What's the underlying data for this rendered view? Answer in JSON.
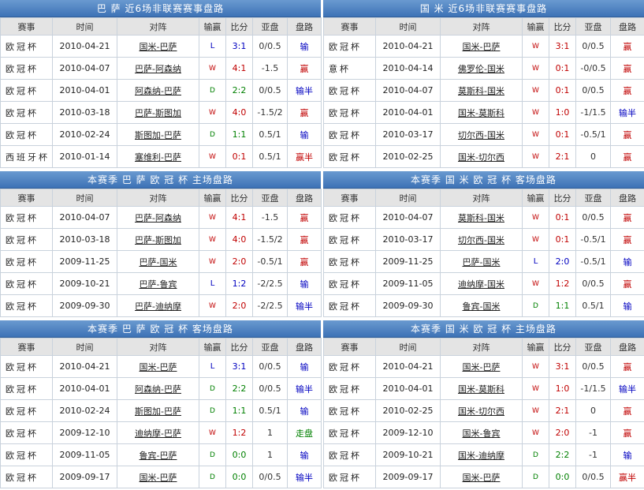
{
  "columns": [
    "赛事",
    "时间",
    "对阵",
    "输赢",
    "比分",
    "亚盘",
    "盘路"
  ],
  "panels": [
    {
      "title": "巴 萨 近6场非联赛赛事盘路",
      "rows": [
        {
          "comp": "欧冠杯",
          "date": "2010-04-21",
          "match": "国米-巴萨",
          "result": "L",
          "score": "3:1",
          "handicap": "0/0.5",
          "pan": "输"
        },
        {
          "comp": "欧冠杯",
          "date": "2010-04-07",
          "match": "巴萨-阿森纳",
          "result": "W",
          "score": "4:1",
          "handicap": "-1.5",
          "pan": "赢"
        },
        {
          "comp": "欧冠杯",
          "date": "2010-04-01",
          "match": "阿森纳-巴萨",
          "result": "D",
          "score": "2:2",
          "handicap": "0/0.5",
          "pan": "输半"
        },
        {
          "comp": "欧冠杯",
          "date": "2010-03-18",
          "match": "巴萨-斯图加",
          "result": "W",
          "score": "4:0",
          "handicap": "-1.5/2",
          "pan": "赢"
        },
        {
          "comp": "欧冠杯",
          "date": "2010-02-24",
          "match": "斯图加-巴萨",
          "result": "D",
          "score": "1:1",
          "handicap": "0.5/1",
          "pan": "输"
        },
        {
          "comp": "西班牙杯",
          "date": "2010-01-14",
          "match": "塞维利-巴萨",
          "result": "W",
          "score": "0:1",
          "handicap": "0.5/1",
          "pan": "赢半"
        }
      ]
    },
    {
      "title": "国 米 近6场非联赛赛事盘路",
      "rows": [
        {
          "comp": "欧冠杯",
          "date": "2010-04-21",
          "match": "国米-巴萨",
          "result": "W",
          "score": "3:1",
          "handicap": "0/0.5",
          "pan": "赢"
        },
        {
          "comp": "意杯",
          "date": "2010-04-14",
          "match": "佛罗伦-国米",
          "result": "W",
          "score": "0:1",
          "handicap": "-0/0.5",
          "pan": "赢"
        },
        {
          "comp": "欧冠杯",
          "date": "2010-04-07",
          "match": "莫斯科-国米",
          "result": "W",
          "score": "0:1",
          "handicap": "0/0.5",
          "pan": "赢"
        },
        {
          "comp": "欧冠杯",
          "date": "2010-04-01",
          "match": "国米-莫斯科",
          "result": "W",
          "score": "1:0",
          "handicap": "-1/1.5",
          "pan": "输半"
        },
        {
          "comp": "欧冠杯",
          "date": "2010-03-17",
          "match": "切尔西-国米",
          "result": "W",
          "score": "0:1",
          "handicap": "-0.5/1",
          "pan": "赢"
        },
        {
          "comp": "欧冠杯",
          "date": "2010-02-25",
          "match": "国米-切尔西",
          "result": "W",
          "score": "2:1",
          "handicap": "0",
          "pan": "赢"
        }
      ]
    },
    {
      "title": "本赛季 巴 萨 欧 冠 杯 主场盘路",
      "rows": [
        {
          "comp": "欧冠杯",
          "date": "2010-04-07",
          "match": "巴萨-阿森纳",
          "result": "W",
          "score": "4:1",
          "handicap": "-1.5",
          "pan": "赢"
        },
        {
          "comp": "欧冠杯",
          "date": "2010-03-18",
          "match": "巴萨-斯图加",
          "result": "W",
          "score": "4:0",
          "handicap": "-1.5/2",
          "pan": "赢"
        },
        {
          "comp": "欧冠杯",
          "date": "2009-11-25",
          "match": "巴萨-国米",
          "result": "W",
          "score": "2:0",
          "handicap": "-0.5/1",
          "pan": "赢"
        },
        {
          "comp": "欧冠杯",
          "date": "2009-10-21",
          "match": "巴萨-鲁宾",
          "result": "L",
          "score": "1:2",
          "handicap": "-2/2.5",
          "pan": "输"
        },
        {
          "comp": "欧冠杯",
          "date": "2009-09-30",
          "match": "巴萨-迪纳摩",
          "result": "W",
          "score": "2:0",
          "handicap": "-2/2.5",
          "pan": "输半"
        }
      ]
    },
    {
      "title": "本赛季 国 米 欧 冠 杯 客场盘路",
      "rows": [
        {
          "comp": "欧冠杯",
          "date": "2010-04-07",
          "match": "莫斯科-国米",
          "result": "W",
          "score": "0:1",
          "handicap": "0/0.5",
          "pan": "赢"
        },
        {
          "comp": "欧冠杯",
          "date": "2010-03-17",
          "match": "切尔西-国米",
          "result": "W",
          "score": "0:1",
          "handicap": "-0.5/1",
          "pan": "赢"
        },
        {
          "comp": "欧冠杯",
          "date": "2009-11-25",
          "match": "巴萨-国米",
          "result": "L",
          "score": "2:0",
          "handicap": "-0.5/1",
          "pan": "输"
        },
        {
          "comp": "欧冠杯",
          "date": "2009-11-05",
          "match": "迪纳摩-国米",
          "result": "W",
          "score": "1:2",
          "handicap": "0/0.5",
          "pan": "赢"
        },
        {
          "comp": "欧冠杯",
          "date": "2009-09-30",
          "match": "鲁宾-国米",
          "result": "D",
          "score": "1:1",
          "handicap": "0.5/1",
          "pan": "输"
        }
      ]
    },
    {
      "title": "本赛季 巴 萨 欧 冠 杯 客场盘路",
      "rows": [
        {
          "comp": "欧冠杯",
          "date": "2010-04-21",
          "match": "国米-巴萨",
          "result": "L",
          "score": "3:1",
          "handicap": "0/0.5",
          "pan": "输"
        },
        {
          "comp": "欧冠杯",
          "date": "2010-04-01",
          "match": "阿森纳-巴萨",
          "result": "D",
          "score": "2:2",
          "handicap": "0/0.5",
          "pan": "输半"
        },
        {
          "comp": "欧冠杯",
          "date": "2010-02-24",
          "match": "斯图加-巴萨",
          "result": "D",
          "score": "1:1",
          "handicap": "0.5/1",
          "pan": "输"
        },
        {
          "comp": "欧冠杯",
          "date": "2009-12-10",
          "match": "迪纳摩-巴萨",
          "result": "W",
          "score": "1:2",
          "handicap": "1",
          "pan": "走盘"
        },
        {
          "comp": "欧冠杯",
          "date": "2009-11-05",
          "match": "鲁宾-巴萨",
          "result": "D",
          "score": "0:0",
          "handicap": "1",
          "pan": "输"
        },
        {
          "comp": "欧冠杯",
          "date": "2009-09-17",
          "match": "国米-巴萨",
          "result": "D",
          "score": "0:0",
          "handicap": "0/0.5",
          "pan": "输半"
        }
      ]
    },
    {
      "title": "本赛季 国 米 欧 冠 杯 主场盘路",
      "rows": [
        {
          "comp": "欧冠杯",
          "date": "2010-04-21",
          "match": "国米-巴萨",
          "result": "W",
          "score": "3:1",
          "handicap": "0/0.5",
          "pan": "赢"
        },
        {
          "comp": "欧冠杯",
          "date": "2010-04-01",
          "match": "国米-莫斯科",
          "result": "W",
          "score": "1:0",
          "handicap": "-1/1.5",
          "pan": "输半"
        },
        {
          "comp": "欧冠杯",
          "date": "2010-02-25",
          "match": "国米-切尔西",
          "result": "W",
          "score": "2:1",
          "handicap": "0",
          "pan": "赢"
        },
        {
          "comp": "欧冠杯",
          "date": "2009-12-10",
          "match": "国米-鲁宾",
          "result": "W",
          "score": "2:0",
          "handicap": "-1",
          "pan": "赢"
        },
        {
          "comp": "欧冠杯",
          "date": "2009-10-21",
          "match": "国米-迪纳摩",
          "result": "D",
          "score": "2:2",
          "handicap": "-1",
          "pan": "输"
        },
        {
          "comp": "欧冠杯",
          "date": "2009-09-17",
          "match": "国米-巴萨",
          "result": "D",
          "score": "0:0",
          "handicap": "0/0.5",
          "pan": "赢半"
        }
      ]
    }
  ]
}
